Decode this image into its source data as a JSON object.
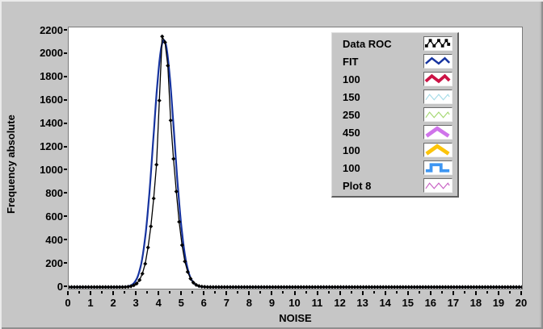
{
  "window": {
    "background": "#c6c6c6"
  },
  "chart": {
    "ylabel": "Frequency absolute",
    "xlabel": "NOISE",
    "plot_bg": "#ffffff"
  },
  "legend": {
    "items": [
      {
        "label": "Data ROC",
        "color": "#000000",
        "pattern": "dotstep",
        "thickness": 1.3
      },
      {
        "label": "FIT",
        "color": "#16339f",
        "pattern": "zigzag",
        "thickness": 2.6
      },
      {
        "label": "100",
        "color": "#cc1245",
        "pattern": "zigzag",
        "thickness": 4
      },
      {
        "label": "150",
        "color": "#a5dce8",
        "pattern": "zigzag3",
        "thickness": 1.2
      },
      {
        "label": "250",
        "color": "#a4d870",
        "pattern": "zigzag3",
        "thickness": 1.2
      },
      {
        "label": "450",
        "color": "#cf74ea",
        "pattern": "chevron",
        "thickness": 5
      },
      {
        "label": "100",
        "color": "#fcc40a",
        "pattern": "chevron",
        "thickness": 5
      },
      {
        "label": "100",
        "color": "#3e96f2",
        "pattern": "pulse",
        "thickness": 4
      },
      {
        "label": "Plot 8",
        "color": "#c75fc3",
        "pattern": "zigzag3",
        "thickness": 1.2
      }
    ]
  },
  "chart_data": {
    "type": "line",
    "title": "",
    "xlabel": "NOISE",
    "ylabel": "Frequency absolute",
    "xlim": [
      0,
      20
    ],
    "ylim": [
      0,
      2200
    ],
    "x_ticks": [
      0,
      1,
      2,
      3,
      4,
      5,
      6,
      7,
      8,
      9,
      10,
      11,
      12,
      13,
      14,
      15,
      16,
      17,
      18,
      19,
      20
    ],
    "x_minor_tick_step": 0.5,
    "y_ticks": [
      0,
      200,
      400,
      600,
      800,
      1000,
      1200,
      1400,
      1600,
      1800,
      2000,
      2200
    ],
    "grid": false,
    "legend_position": "top-right",
    "series": [
      {
        "name": "Data ROC",
        "color": "#000000",
        "marker": "diamond",
        "line_width": 1.3,
        "x_start": 2.5,
        "x_step": 0.125,
        "baseline_value": 0,
        "values": [
          1,
          3,
          7,
          15,
          30,
          60,
          115,
          200,
          340,
          520,
          760,
          1050,
          1600,
          2150,
          2100,
          1900,
          1430,
          1100,
          820,
          560,
          360,
          220,
          130,
          72,
          38,
          19,
          9,
          4,
          2,
          1,
          0
        ]
      },
      {
        "name": "FIT",
        "color": "#16339f",
        "line_width": 2.2,
        "fit": "gaussian",
        "amplitude": 2120,
        "mean": 4.2,
        "sigma": 0.46
      }
    ]
  }
}
